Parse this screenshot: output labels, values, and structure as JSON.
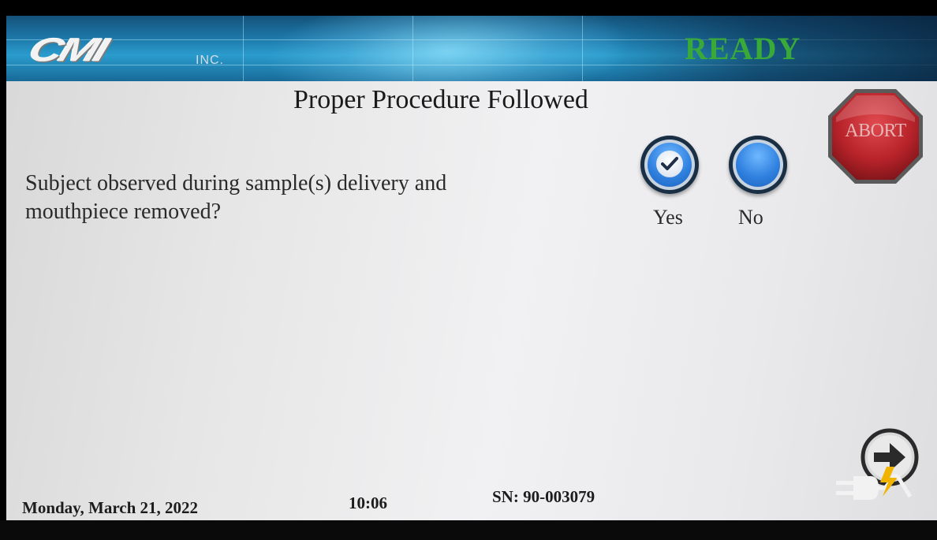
{
  "header": {
    "logo_text": "CMI",
    "logo_inc": "INC.",
    "status": "READY",
    "status_color": "#39a93a"
  },
  "page": {
    "title": "Proper Procedure Followed",
    "question_line1": "Subject observed during sample(s) delivery and",
    "question_line2": "mouthpiece removed?"
  },
  "options": {
    "yes_label": "Yes",
    "no_label": "No",
    "selected": "Yes",
    "radio_color": "#2f80df"
  },
  "buttons": {
    "abort_label": "ABORT",
    "abort_color": "#c0272d",
    "next_icon": "arrow-right-icon"
  },
  "footer": {
    "date": "Monday, March 21, 2022",
    "time": "10:06",
    "serial": "SN: 90-003079",
    "power_icon": "ac-power-plug-icon"
  }
}
